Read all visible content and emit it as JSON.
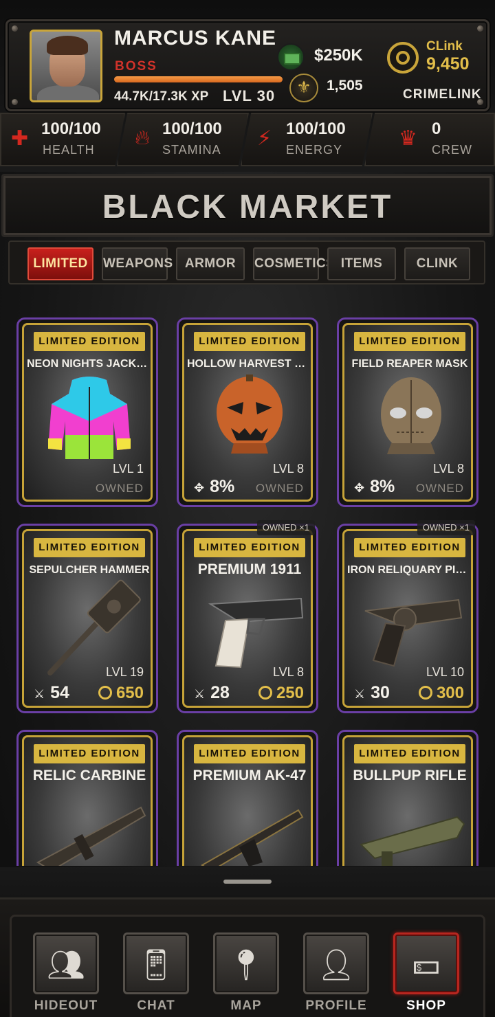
{
  "player": {
    "name": "MARCUS KANE",
    "rank": "BOSS",
    "xp_text": "44.7K/17.3K XP",
    "xp_progress": 1.0,
    "level_text": "LVL 30",
    "cash": "$250K",
    "reputation": "1,505",
    "clink_label": "CLink",
    "clink_value": "9,450",
    "network": "CRIMELINK"
  },
  "stats": [
    {
      "icon": "health-cross-icon",
      "value": "100/100",
      "label": "HEALTH"
    },
    {
      "icon": "stamina-flame-icon",
      "value": "100/100",
      "label": "STAMINA"
    },
    {
      "icon": "energy-bolt-icon",
      "value": "100/100",
      "label": "ENERGY"
    },
    {
      "icon": "crew-crown-icon",
      "value": "0",
      "label": "CREW"
    }
  ],
  "page_title": "BLACK MARKET",
  "tabs": [
    {
      "label": "LIMITED",
      "active": true
    },
    {
      "label": "WEAPONS",
      "active": false
    },
    {
      "label": "ARMOR",
      "active": false
    },
    {
      "label": "COSMETICS",
      "active": false
    },
    {
      "label": "ITEMS",
      "active": false
    },
    {
      "label": "CLINK",
      "active": false
    }
  ],
  "cards": [
    {
      "badge": "LIMITED EDITION",
      "name": "NEON NIGHTS JACKET (PRI...",
      "level": "LVL 1",
      "owned": "OWNED",
      "stat": "",
      "price": "",
      "owned_count": ""
    },
    {
      "badge": "LIMITED EDITION",
      "name": "HOLLOW HARVEST MASK",
      "level": "LVL 8",
      "owned": "OWNED",
      "stat": "8%",
      "price": "",
      "owned_count": ""
    },
    {
      "badge": "LIMITED EDITION",
      "name": "FIELD REAPER MASK",
      "level": "LVL 8",
      "owned": "OWNED",
      "stat": "8%",
      "price": "",
      "owned_count": ""
    },
    {
      "badge": "LIMITED EDITION",
      "name": "SEPULCHER HAMMER",
      "level": "LVL 19",
      "owned": "",
      "stat": "54",
      "price": "650",
      "owned_count": ""
    },
    {
      "badge": "LIMITED EDITION",
      "name": "PREMIUM 1911",
      "level": "LVL 8",
      "owned": "",
      "stat": "28",
      "price": "250",
      "owned_count": "OWNED ×1"
    },
    {
      "badge": "LIMITED EDITION",
      "name": "IRON RELIQUARY PISTOL",
      "level": "LVL 10",
      "owned": "",
      "stat": "30",
      "price": "300",
      "owned_count": "OWNED ×1"
    },
    {
      "badge": "LIMITED EDITION",
      "name": "RELIC CARBINE",
      "level": "",
      "owned": "",
      "stat": "",
      "price": "",
      "owned_count": ""
    },
    {
      "badge": "LIMITED EDITION",
      "name": "PREMIUM AK-47",
      "level": "",
      "owned": "",
      "stat": "",
      "price": "",
      "owned_count": ""
    },
    {
      "badge": "LIMITED EDITION",
      "name": "BULLPUP RIFLE",
      "level": "",
      "owned": "",
      "stat": "",
      "price": "",
      "owned_count": ""
    }
  ],
  "nav": [
    {
      "label": "HIDEOUT",
      "icon": "hideout-people-icon",
      "active": false
    },
    {
      "label": "CHAT",
      "icon": "chat-phone-icon",
      "active": false
    },
    {
      "label": "MAP",
      "icon": "map-pin-icon",
      "active": false
    },
    {
      "label": "PROFILE",
      "icon": "profile-person-icon",
      "active": false
    },
    {
      "label": "SHOP",
      "icon": "shop-cash-icon",
      "active": true
    }
  ],
  "colors": {
    "accent_gold": "#d8b640",
    "card_border_purple": "#6a3fa5",
    "active_tab_red": "#c8201c",
    "rank_red": "#d0322a"
  }
}
